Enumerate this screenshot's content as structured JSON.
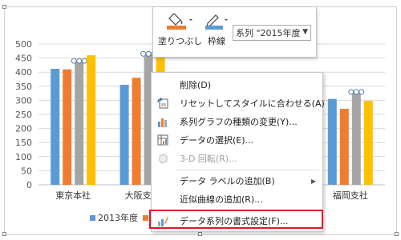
{
  "chart_data": {
    "type": "bar",
    "title": "",
    "categories": [
      "東京本社",
      "大阪支社",
      "",
      "",
      "福岡支社"
    ],
    "ylim": [
      0,
      500
    ],
    "yticks": [
      0,
      50,
      100,
      150,
      200,
      250,
      300,
      350,
      400,
      450,
      500
    ],
    "grid": true,
    "legend_position": "bottom",
    "series": [
      {
        "name": "2013年度",
        "color": "#5B9BD5",
        "values": [
          412,
          355,
          null,
          null,
          305
        ]
      },
      {
        "name": "",
        "color": "#ED7D31",
        "values": [
          410,
          380,
          null,
          null,
          270
        ]
      },
      {
        "name": "",
        "color": "#A5A5A5",
        "values": [
          440,
          465,
          null,
          null,
          330
        ]
      },
      {
        "name": "",
        "color": "#FFC000",
        "values": [
          460,
          470,
          null,
          null,
          298
        ]
      }
    ],
    "selected_series_index": 2
  },
  "legend": {
    "items": [
      {
        "label": "2013年度",
        "color": "#5B9BD5"
      },
      {
        "label": "",
        "color": "#ED7D31"
      }
    ]
  },
  "toolbar": {
    "fill_label": "塗りつぶし",
    "outline_label": "枠線",
    "series_select_value": "系列 \"2015年度",
    "fill_color": "#ED7D31",
    "outline_color": "#5B9BD5"
  },
  "context_menu": {
    "items": [
      {
        "label": "削除(D)",
        "icon": "none",
        "enabled": true
      },
      {
        "label": "リセットしてスタイルに合わせる(A)",
        "icon": "reset-style-icon",
        "enabled": true
      },
      {
        "label": "系列グラフの種類の変更(Y)...",
        "icon": "chart-type-icon",
        "enabled": true
      },
      {
        "label": "データの選択(E)...",
        "icon": "select-data-icon",
        "enabled": true
      },
      {
        "label": "3-D 回転(R)...",
        "icon": "3d-rotate-icon",
        "enabled": false
      },
      {
        "label": "データ ラベルの追加(B)",
        "icon": "none",
        "enabled": true,
        "submenu": true
      },
      {
        "label": "近似曲線の追加(R)...",
        "icon": "none",
        "enabled": true
      },
      {
        "label": "データ系列の書式設定(F)...",
        "icon": "format-series-icon",
        "enabled": true,
        "highlighted": true
      }
    ],
    "highlight_color": "#E8132C"
  }
}
